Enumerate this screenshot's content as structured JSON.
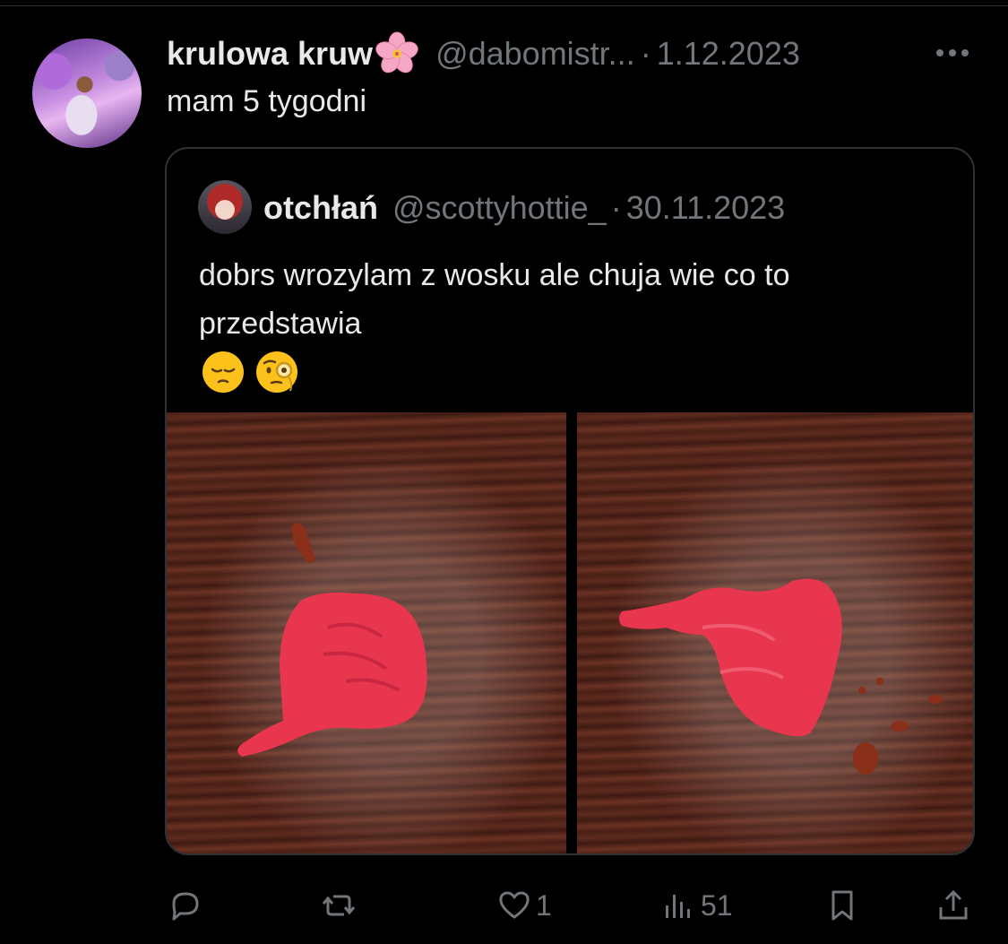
{
  "post": {
    "author_name": "krulowa kruw",
    "author_emoji": "cherry-blossom",
    "handle": "@dabomistr...",
    "separator": "·",
    "date": "1.12.2023",
    "text": "mam 5 tygodni"
  },
  "quoted": {
    "author_name": "otchłań",
    "handle": "@scottyhottie_",
    "separator": "·",
    "date": "30.11.2023",
    "text": "dobrs wrozylam z wosku ale chuja wie co to przedstawia",
    "emojis": [
      "pensive-face-emoji",
      "face-with-monocle-emoji"
    ],
    "images": [
      "red-wax-photo-left",
      "red-wax-photo-right"
    ]
  },
  "actions": {
    "reply_count": "",
    "repost_count": "",
    "like_count": "1",
    "views_count": "51"
  },
  "colors": {
    "background": "#000000",
    "text": "#e7e9ea",
    "secondary": "#71767b",
    "border": "#2f3336",
    "wax": "#e8364f"
  }
}
